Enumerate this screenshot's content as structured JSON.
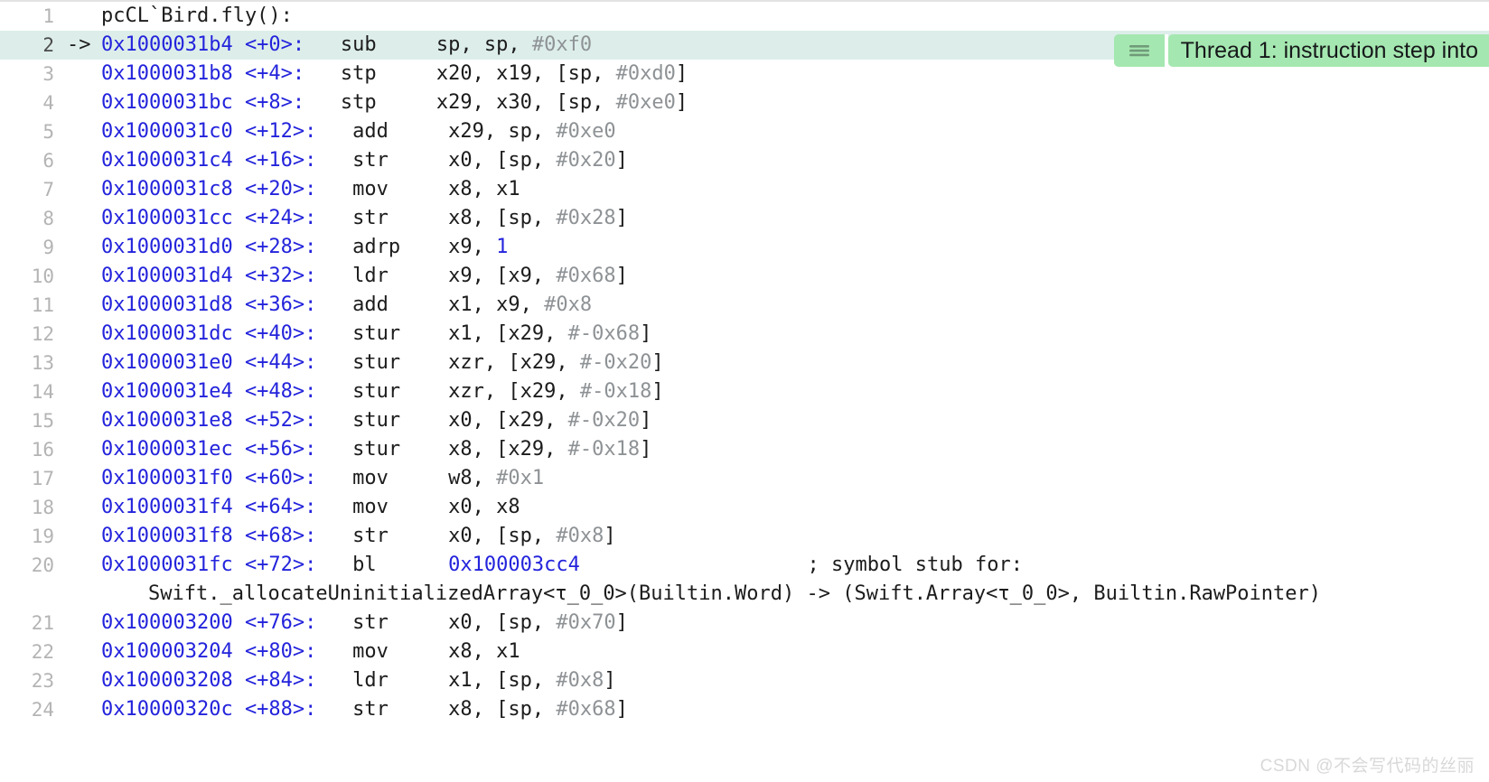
{
  "view": {
    "title": "pcCL`Bird.fly():",
    "colors": {
      "address": "#2323dc",
      "immediate": "#8e9295",
      "text": "#1c1c1c",
      "gutter": "#b4b4b4",
      "current_line_bg": "#ddeeea",
      "annotation_bg": "#a5e7b0",
      "background": "#ffffff"
    }
  },
  "annotation": {
    "icon": "hamburger-menu-icon",
    "text": "Thread 1: instruction step into"
  },
  "watermark": {
    "text": "CSDN @不会写代码的丝丽"
  },
  "lines": [
    {
      "num": "1",
      "arrow": "",
      "current": false,
      "kind": "symbol",
      "symbol": "pcCL`Bird.fly():"
    },
    {
      "num": "2",
      "arrow": "->",
      "current": true,
      "kind": "insn",
      "address": "0x1000031b4 <+0>:",
      "mnemonic": "sub",
      "operands_pre": "sp, sp, ",
      "immediate": "#0xf0",
      "operands_post": ""
    },
    {
      "num": "3",
      "arrow": "",
      "current": false,
      "kind": "insn",
      "address": "0x1000031b8 <+4>:",
      "mnemonic": "stp",
      "operands_pre": "x20, x19, [sp, ",
      "immediate": "#0xd0",
      "operands_post": "]"
    },
    {
      "num": "4",
      "arrow": "",
      "current": false,
      "kind": "insn",
      "address": "0x1000031bc <+8>:",
      "mnemonic": "stp",
      "operands_pre": "x29, x30, [sp, ",
      "immediate": "#0xe0",
      "operands_post": "]"
    },
    {
      "num": "5",
      "arrow": "",
      "current": false,
      "kind": "insn",
      "address": "0x1000031c0 <+12>:",
      "mnemonic": "add",
      "operands_pre": "x29, sp, ",
      "immediate": "#0xe0",
      "operands_post": ""
    },
    {
      "num": "6",
      "arrow": "",
      "current": false,
      "kind": "insn",
      "address": "0x1000031c4 <+16>:",
      "mnemonic": "str",
      "operands_pre": "x0, [sp, ",
      "immediate": "#0x20",
      "operands_post": "]"
    },
    {
      "num": "7",
      "arrow": "",
      "current": false,
      "kind": "insn",
      "address": "0x1000031c8 <+20>:",
      "mnemonic": "mov",
      "operands_pre": "x8, x1",
      "immediate": "",
      "operands_post": ""
    },
    {
      "num": "8",
      "arrow": "",
      "current": false,
      "kind": "insn",
      "address": "0x1000031cc <+24>:",
      "mnemonic": "str",
      "operands_pre": "x8, [sp, ",
      "immediate": "#0x28",
      "operands_post": "]"
    },
    {
      "num": "9",
      "arrow": "",
      "current": false,
      "kind": "insn",
      "address": "0x1000031d0 <+28>:",
      "mnemonic": "adrp",
      "operands_pre": "x9, ",
      "immediate": "",
      "operands_post": "",
      "operand_target": "1"
    },
    {
      "num": "10",
      "arrow": "",
      "current": false,
      "kind": "insn",
      "address": "0x1000031d4 <+32>:",
      "mnemonic": "ldr",
      "operands_pre": "x9, [x9, ",
      "immediate": "#0x68",
      "operands_post": "]"
    },
    {
      "num": "11",
      "arrow": "",
      "current": false,
      "kind": "insn",
      "address": "0x1000031d8 <+36>:",
      "mnemonic": "add",
      "operands_pre": "x1, x9, ",
      "immediate": "#0x8",
      "operands_post": ""
    },
    {
      "num": "12",
      "arrow": "",
      "current": false,
      "kind": "insn",
      "address": "0x1000031dc <+40>:",
      "mnemonic": "stur",
      "operands_pre": "x1, [x29, ",
      "immediate": "#-0x68",
      "operands_post": "]"
    },
    {
      "num": "13",
      "arrow": "",
      "current": false,
      "kind": "insn",
      "address": "0x1000031e0 <+44>:",
      "mnemonic": "stur",
      "operands_pre": "xzr, [x29, ",
      "immediate": "#-0x20",
      "operands_post": "]"
    },
    {
      "num": "14",
      "arrow": "",
      "current": false,
      "kind": "insn",
      "address": "0x1000031e4 <+48>:",
      "mnemonic": "stur",
      "operands_pre": "xzr, [x29, ",
      "immediate": "#-0x18",
      "operands_post": "]"
    },
    {
      "num": "15",
      "arrow": "",
      "current": false,
      "kind": "insn",
      "address": "0x1000031e8 <+52>:",
      "mnemonic": "stur",
      "operands_pre": "x0, [x29, ",
      "immediate": "#-0x20",
      "operands_post": "]"
    },
    {
      "num": "16",
      "arrow": "",
      "current": false,
      "kind": "insn",
      "address": "0x1000031ec <+56>:",
      "mnemonic": "stur",
      "operands_pre": "x8, [x29, ",
      "immediate": "#-0x18",
      "operands_post": "]"
    },
    {
      "num": "17",
      "arrow": "",
      "current": false,
      "kind": "insn",
      "address": "0x1000031f0 <+60>:",
      "mnemonic": "mov",
      "operands_pre": "w8, ",
      "immediate": "#0x1",
      "operands_post": ""
    },
    {
      "num": "18",
      "arrow": "",
      "current": false,
      "kind": "insn",
      "address": "0x1000031f4 <+64>:",
      "mnemonic": "mov",
      "operands_pre": "x0, x8",
      "immediate": "",
      "operands_post": ""
    },
    {
      "num": "19",
      "arrow": "",
      "current": false,
      "kind": "insn",
      "address": "0x1000031f8 <+68>:",
      "mnemonic": "str",
      "operands_pre": "x0, [sp, ",
      "immediate": "#0x8",
      "operands_post": "]"
    },
    {
      "num": "20",
      "arrow": "",
      "current": false,
      "kind": "insn-comment",
      "address": "0x1000031fc <+72>:",
      "mnemonic": "bl",
      "operands_pre": "",
      "immediate": "",
      "operands_post": "",
      "branch_target": "0x100003cc4",
      "comment": "; symbol stub for:",
      "continuation": "Swift._allocateUninitializedArray<τ_0_0>(Builtin.Word) -> (Swift.Array<τ_0_0>, Builtin.RawPointer)"
    },
    {
      "num": "21",
      "arrow": "",
      "current": false,
      "kind": "insn",
      "address": "0x100003200 <+76>:",
      "mnemonic": "str",
      "operands_pre": "x0, [sp, ",
      "immediate": "#0x70",
      "operands_post": "]"
    },
    {
      "num": "22",
      "arrow": "",
      "current": false,
      "kind": "insn",
      "address": "0x100003204 <+80>:",
      "mnemonic": "mov",
      "operands_pre": "x8, x1",
      "immediate": "",
      "operands_post": ""
    },
    {
      "num": "23",
      "arrow": "",
      "current": false,
      "kind": "insn",
      "address": "0x100003208 <+84>:",
      "mnemonic": "ldr",
      "operands_pre": "x1, [sp, ",
      "immediate": "#0x8",
      "operands_post": "]"
    },
    {
      "num": "24",
      "arrow": "",
      "current": false,
      "kind": "insn",
      "address": "0x10000320c <+88>:",
      "mnemonic": "str",
      "operands_pre": "x8, [sp, ",
      "immediate": "#0x68",
      "operands_post": "]"
    }
  ]
}
